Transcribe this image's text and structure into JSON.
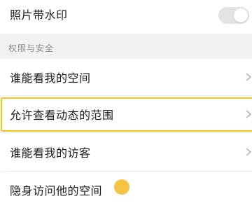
{
  "settings": {
    "photo_watermark": {
      "label": "照片带水印",
      "enabled": false
    },
    "privacy_section": {
      "title": "权限与安全"
    },
    "items": [
      {
        "label": "谁能看我的空间"
      },
      {
        "label": "允许查看动态的范围"
      },
      {
        "label": "谁能看我的访客"
      },
      {
        "label": "隐身访问他的空间"
      }
    ]
  },
  "colors": {
    "highlight": "#f5c518",
    "badge": "#f6c343",
    "background": "#f2f2f2"
  },
  "icons": {
    "chevron": "chevron-right-icon"
  }
}
